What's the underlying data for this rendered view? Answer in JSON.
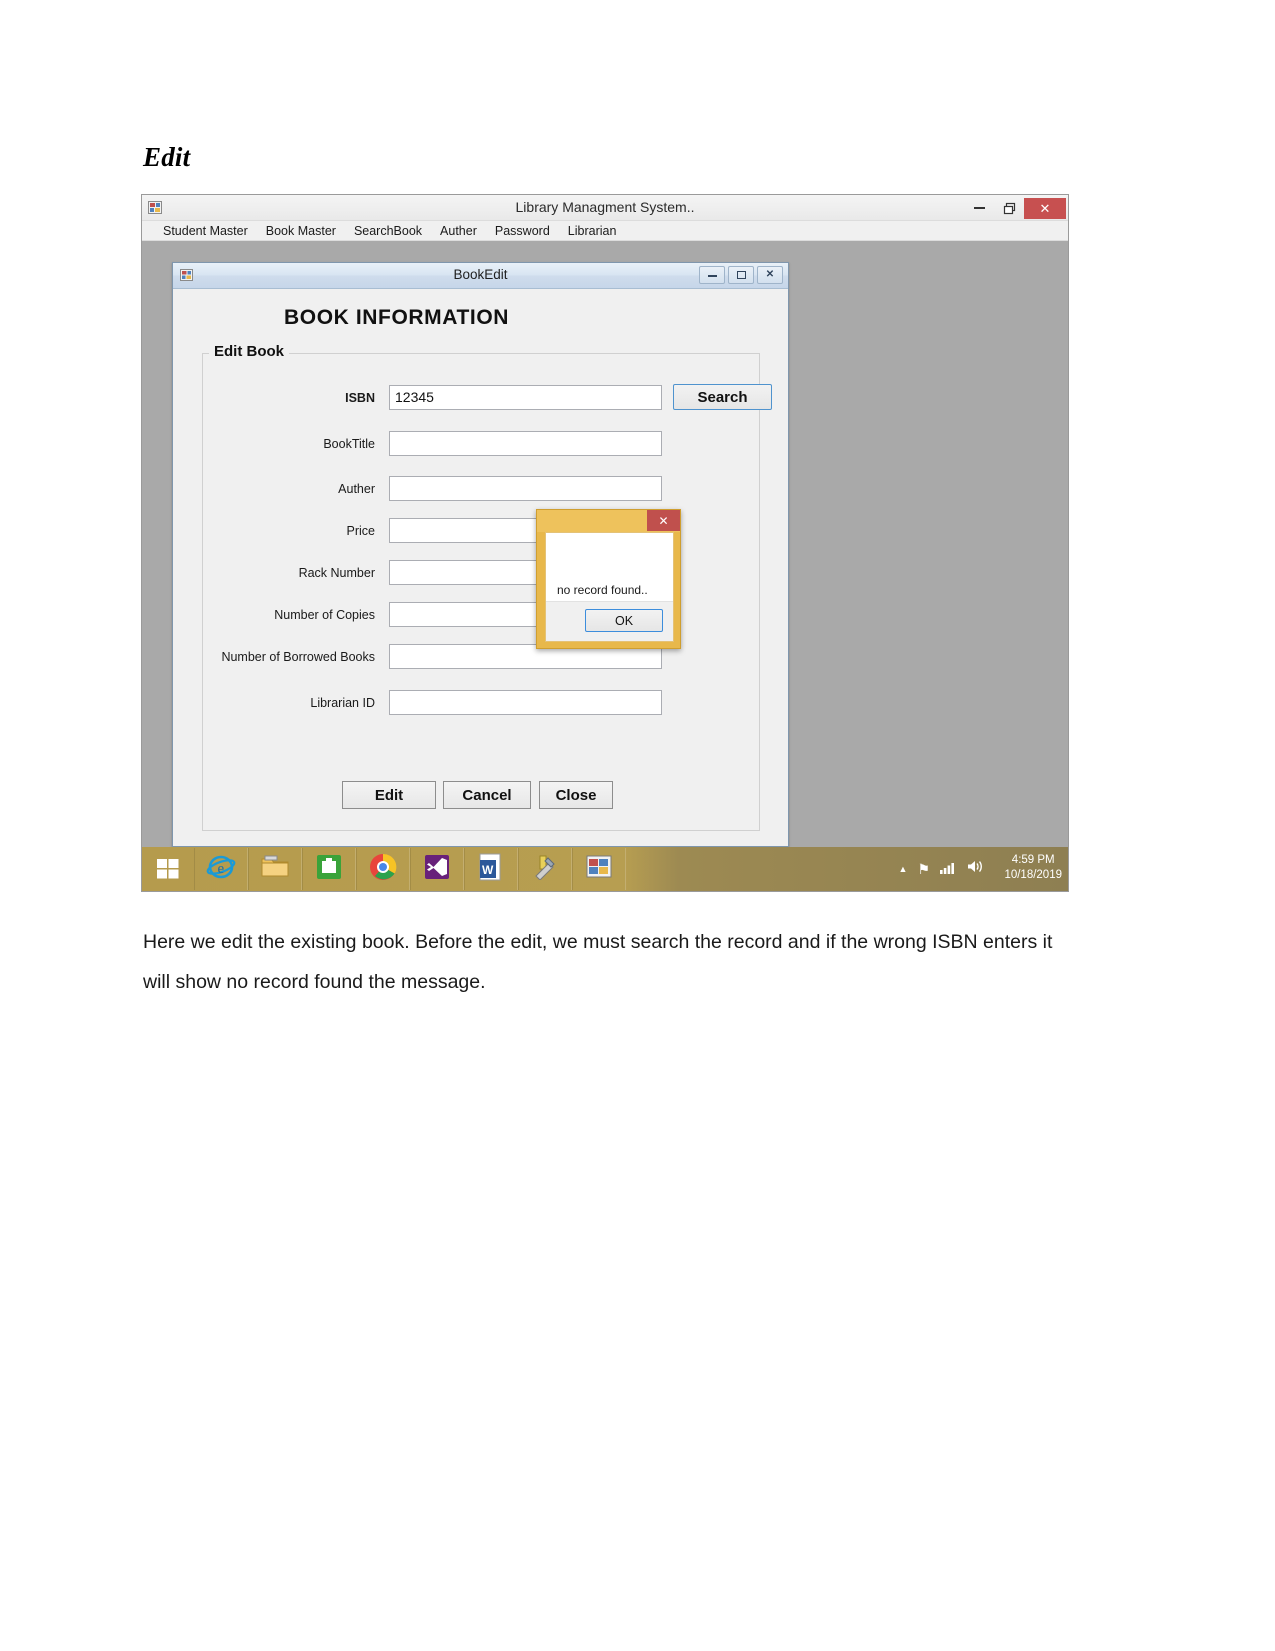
{
  "document": {
    "heading": "Edit",
    "paragraph": "Here we edit the existing book. Before the edit, we must search the record and if the wrong ISBN enters it will show no record found the message."
  },
  "parent_window": {
    "title": "Library Managment System..",
    "icon": "app-window-icon",
    "minimize_label": "–",
    "maximize_label": "❐",
    "close_label": "✕",
    "menu": [
      {
        "label": "Student Master"
      },
      {
        "label": "Book Master"
      },
      {
        "label": "SearchBook"
      },
      {
        "label": "Auther"
      },
      {
        "label": "Password"
      },
      {
        "label": "Librarian"
      }
    ]
  },
  "child_window": {
    "title": "BookEdit",
    "icon": "app-window-icon",
    "minimize_label": "–",
    "maximize_label": "□",
    "close_label": "✕",
    "form_heading": "BOOK INFORMATION",
    "groupbox_label": "Edit Book",
    "fields": [
      {
        "label": "ISBN",
        "value": "12345",
        "placeholder": ""
      },
      {
        "label": "BookTitle",
        "value": "",
        "placeholder": ""
      },
      {
        "label": "Auther",
        "value": "",
        "placeholder": ""
      },
      {
        "label": "Price",
        "value": "",
        "placeholder": ""
      },
      {
        "label": "Rack Number",
        "value": "",
        "placeholder": ""
      },
      {
        "label": "Number of Copies",
        "value": "",
        "placeholder": ""
      },
      {
        "label": "Number of Borrowed Books",
        "value": "",
        "placeholder": ""
      },
      {
        "label": "Librarian ID",
        "value": "",
        "placeholder": ""
      }
    ],
    "search_button": "Search",
    "action_buttons": [
      {
        "label": "Edit"
      },
      {
        "label": "Cancel"
      },
      {
        "label": "Close"
      }
    ]
  },
  "message_box": {
    "title": "",
    "close_label": "✕",
    "message": "no record found..",
    "ok_label": "OK"
  },
  "taskbar": {
    "start_icon": "windows-start-icon",
    "items": [
      {
        "icon": "internet-explorer-icon"
      },
      {
        "icon": "file-explorer-icon"
      },
      {
        "icon": "store-icon"
      },
      {
        "icon": "google-chrome-icon"
      },
      {
        "icon": "visual-studio-icon"
      },
      {
        "icon": "microsoft-word-icon"
      },
      {
        "icon": "tools-icon"
      },
      {
        "icon": "library-app-icon"
      }
    ],
    "tray": [
      {
        "icon": "show-hidden-icons-icon",
        "label": "▲"
      },
      {
        "icon": "flag-action-center-icon",
        "label": "⚑"
      },
      {
        "icon": "network-signal-icon",
        "label": ""
      },
      {
        "icon": "volume-icon",
        "label": ""
      }
    ],
    "time": "4:59 PM",
    "date": "10/18/2019"
  },
  "colors": {
    "desktop_gray": "#a9a9a9",
    "msgbox_gold": "#e8b84b",
    "msgbox_close_red": "#c0504d",
    "accent_blue": "#3c8ddc",
    "taskbar_gold": "#b59b4d"
  }
}
